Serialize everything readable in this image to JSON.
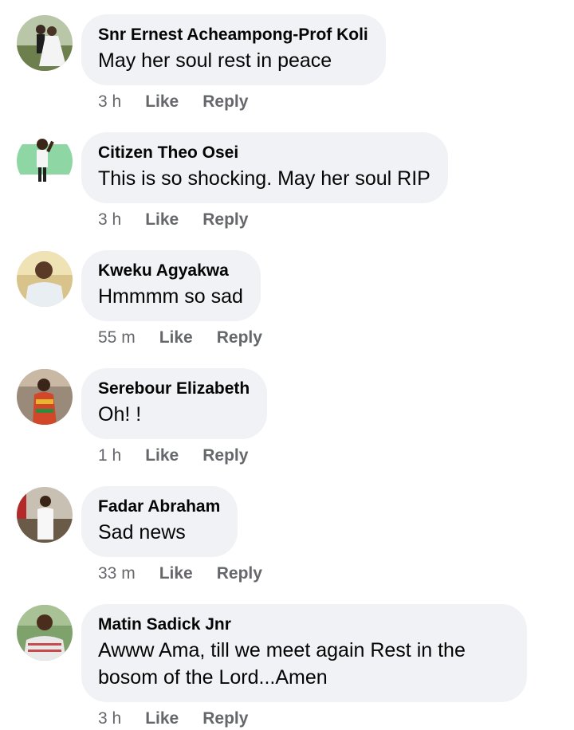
{
  "comments": [
    {
      "author": "Snr Ernest Acheampong-Prof Koli",
      "text": "May her soul rest in peace",
      "time": "3 h",
      "like_label": "Like",
      "reply_label": "Reply",
      "avatar_icon": "photo-bride-groom-icon"
    },
    {
      "author": "Citizen Theo Osei",
      "text": "This is so shocking. May her soul RIP",
      "time": "3 h",
      "like_label": "Like",
      "reply_label": "Reply",
      "avatar_icon": "avatar-cartoon-icon"
    },
    {
      "author": "Kweku Agyakwa",
      "text": "Hmmmm so sad",
      "time": "55 m",
      "like_label": "Like",
      "reply_label": "Reply",
      "avatar_icon": "photo-man-white-shirt-icon"
    },
    {
      "author": "Serebour Elizabeth",
      "text": "Oh! !",
      "time": "1 h",
      "like_label": "Like",
      "reply_label": "Reply",
      "avatar_icon": "photo-woman-kente-icon"
    },
    {
      "author": "Fadar Abraham",
      "text": "Sad news",
      "time": "33 m",
      "like_label": "Like",
      "reply_label": "Reply",
      "avatar_icon": "photo-man-white-suit-icon"
    },
    {
      "author": "Matin Sadick Jnr",
      "text": "Awww Ama, till we meet again Rest in the bosom of the Lord...Amen",
      "time": "3 h",
      "like_label": "Like",
      "reply_label": "Reply",
      "avatar_icon": "photo-man-striped-shirt-icon"
    }
  ],
  "colors": {
    "bubble_bg": "#f0f2f5",
    "name_text": "#050505",
    "meta_text": "#65676b"
  }
}
